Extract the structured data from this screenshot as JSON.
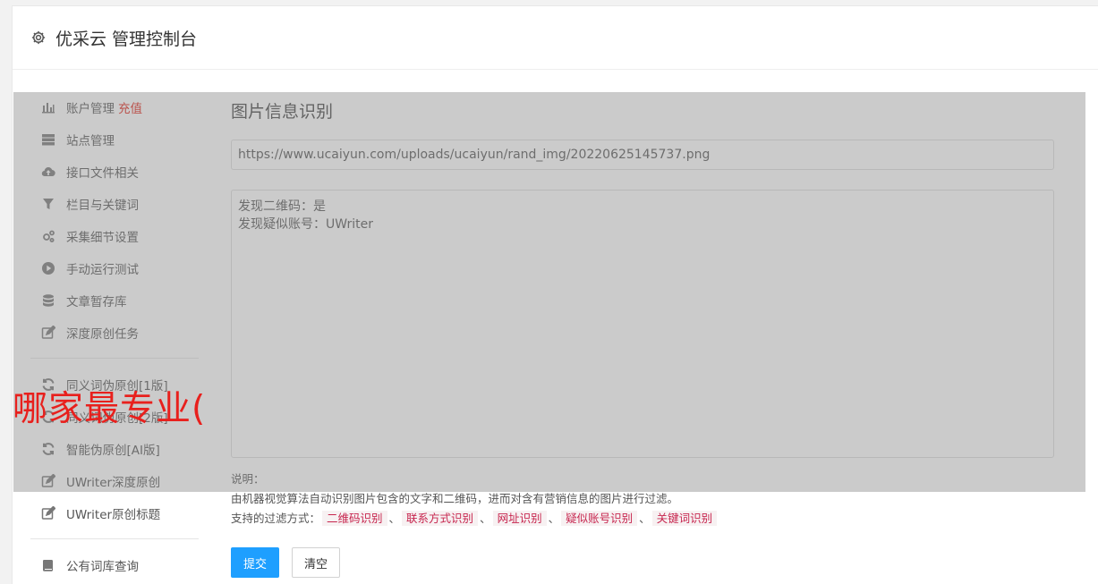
{
  "header": {
    "title": "优采云 管理控制台",
    "icon": "gear-icon"
  },
  "sidebar": {
    "items": [
      {
        "label": "账户管理",
        "icon": "bar-chart-icon",
        "extra": "充值"
      },
      {
        "label": "站点管理",
        "icon": "server-icon"
      },
      {
        "label": "接口文件相关",
        "icon": "cloud-upload-icon"
      },
      {
        "label": "栏目与关键词",
        "icon": "filter-icon"
      },
      {
        "label": "采集细节设置",
        "icon": "gears-icon"
      },
      {
        "label": "手动运行测试",
        "icon": "play-circle-icon"
      },
      {
        "label": "文章暂存库",
        "icon": "database-icon"
      },
      {
        "label": "深度原创任务",
        "icon": "edit-icon"
      }
    ],
    "items2": [
      {
        "label": "同义词伪原创[1版]",
        "icon": "refresh-icon"
      },
      {
        "label": "同义词伪原创[2版]",
        "icon": "refresh-icon"
      },
      {
        "label": "智能伪原创[AI版]",
        "icon": "refresh-icon"
      },
      {
        "label": "UWriter深度原创",
        "icon": "edit-icon"
      },
      {
        "label": "UWriter原创标题",
        "icon": "edit-icon"
      }
    ],
    "items3": [
      {
        "label": "公有词库查询",
        "icon": "book-icon"
      }
    ]
  },
  "main": {
    "title": "图片信息识别",
    "url_value": "https://www.ucaiyun.com/uploads/ucaiyun/rand_img/20220625145737.png",
    "result_lines": [
      "发现二维码：是",
      "发现疑似账号：UWriter"
    ],
    "notes_label": "说明：",
    "notes_text": "由机器视觉算法自动识别图片包含的文字和二维码，进而对含有营销信息的图片进行过滤。",
    "filters_label": "支持的过滤方式：",
    "filters": [
      "二维码识别",
      "联系方式识别",
      "网址识别",
      "疑似账号识别",
      "关键词识别"
    ],
    "filter_sep": "、",
    "submit_label": "提交",
    "clear_label": "清空"
  },
  "watermark": {
    "text": "哪家最专业("
  },
  "colors": {
    "accent": "#1e9fff",
    "danger": "#e0251a",
    "tag_text": "#c7254e",
    "tag_bg": "#f7f1f2"
  }
}
